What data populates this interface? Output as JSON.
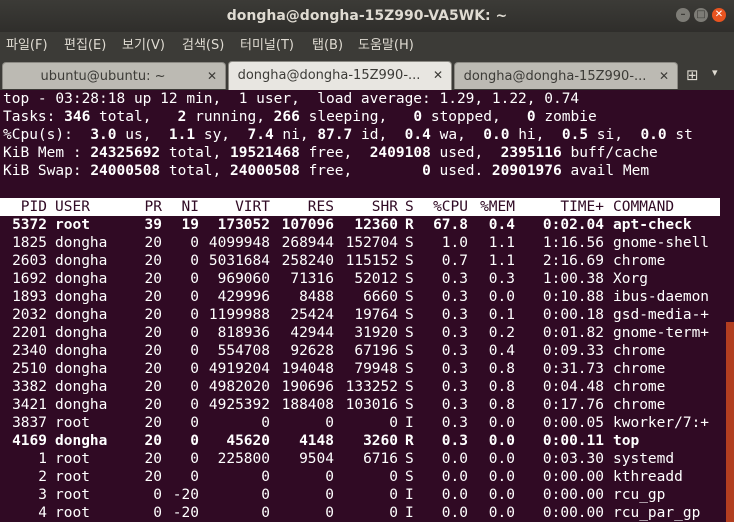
{
  "window": {
    "title": "dongha@dongha-15Z990-VA5WK: ~",
    "buttons": {
      "minimize": "–",
      "maximize": "□",
      "close": "✕"
    }
  },
  "menu": [
    "파일(F)",
    "편집(E)",
    "보기(V)",
    "검색(S)",
    "터미널(T)",
    "탭(B)",
    "도움말(H)"
  ],
  "tabs": [
    {
      "label": "ubuntu@ubuntu: ~",
      "close": "✕"
    },
    {
      "label": "dongha@dongha-15Z990-...",
      "close": "✕"
    },
    {
      "label": "dongha@dongha-15Z990-...",
      "close": "✕"
    }
  ],
  "tab_actions": {
    "new_tab": "⊞",
    "menu": "▾"
  },
  "summary": {
    "l1": "top - 03:28:18 up 12 min,  1 user,  load average: 1.29, 1.22, 0.74",
    "tasks": {
      "label": "Tasks: ",
      "total": "346",
      "total_lbl": " total,   ",
      "running": "2",
      "running_lbl": " running, ",
      "sleeping": "266",
      "sleeping_lbl": " sleeping,   ",
      "stopped": "0",
      "stopped_lbl": " stopped,   ",
      "zombie": "0",
      "zombie_lbl": " zombie"
    },
    "cpu": {
      "label": "%Cpu(s):  ",
      "us": "3.0",
      "us_lbl": " us,  ",
      "sy": "1.1",
      "sy_lbl": " sy,  ",
      "ni": "7.4",
      "ni_lbl": " ni, ",
      "id": "87.7",
      "id_lbl": " id,  ",
      "wa": "0.4",
      "wa_lbl": " wa,  ",
      "hi": "0.0",
      "hi_lbl": " hi,  ",
      "si": "0.5",
      "si_lbl": " si,  ",
      "st": "0.0",
      "st_lbl": " st"
    },
    "mem": {
      "label": "KiB Mem : ",
      "total": "24325692",
      "total_lbl": " total, ",
      "free": "19521468",
      "free_lbl": " free,  ",
      "used": "2409108",
      "used_lbl": " used,  ",
      "buff": "2395116",
      "buff_lbl": " buff/cache"
    },
    "swap": {
      "label": "KiB Swap: ",
      "total": "24000508",
      "total_lbl": " total, ",
      "free": "24000508",
      "free_lbl": " free,        ",
      "used": "0",
      "used_lbl": " used. ",
      "avail": "20901976",
      "avail_lbl": " avail Mem"
    }
  },
  "columns": [
    "PID",
    "USER",
    "PR",
    "NI",
    "VIRT",
    "RES",
    "SHR",
    "S",
    "%CPU",
    "%MEM",
    "TIME+",
    "COMMAND"
  ],
  "processes": [
    {
      "bold": true,
      "c": [
        "5372",
        "root",
        "39",
        "19",
        "173052",
        "107096",
        "12360",
        "R",
        "67.8",
        "0.4",
        "0:02.04",
        "apt-check"
      ]
    },
    {
      "bold": false,
      "c": [
        "1825",
        "dongha",
        "20",
        "0",
        "4099948",
        "268944",
        "152704",
        "S",
        "1.0",
        "1.1",
        "1:16.56",
        "gnome-shell"
      ]
    },
    {
      "bold": false,
      "c": [
        "2603",
        "dongha",
        "20",
        "0",
        "5031684",
        "258240",
        "115152",
        "S",
        "0.7",
        "1.1",
        "2:16.69",
        "chrome"
      ]
    },
    {
      "bold": false,
      "c": [
        "1692",
        "dongha",
        "20",
        "0",
        "969060",
        "71316",
        "52012",
        "S",
        "0.3",
        "0.3",
        "1:00.38",
        "Xorg"
      ]
    },
    {
      "bold": false,
      "c": [
        "1893",
        "dongha",
        "20",
        "0",
        "429996",
        "8488",
        "6660",
        "S",
        "0.3",
        "0.0",
        "0:10.88",
        "ibus-daemon"
      ]
    },
    {
      "bold": false,
      "c": [
        "2032",
        "dongha",
        "20",
        "0",
        "1199988",
        "25424",
        "19764",
        "S",
        "0.3",
        "0.1",
        "0:00.18",
        "gsd-media-+"
      ]
    },
    {
      "bold": false,
      "c": [
        "2201",
        "dongha",
        "20",
        "0",
        "818936",
        "42944",
        "31920",
        "S",
        "0.3",
        "0.2",
        "0:01.82",
        "gnome-term+"
      ]
    },
    {
      "bold": false,
      "c": [
        "2340",
        "dongha",
        "20",
        "0",
        "554708",
        "92628",
        "67196",
        "S",
        "0.3",
        "0.4",
        "0:09.33",
        "chrome"
      ]
    },
    {
      "bold": false,
      "c": [
        "2510",
        "dongha",
        "20",
        "0",
        "4919204",
        "194048",
        "79948",
        "S",
        "0.3",
        "0.8",
        "0:31.73",
        "chrome"
      ]
    },
    {
      "bold": false,
      "c": [
        "3382",
        "dongha",
        "20",
        "0",
        "4982020",
        "190696",
        "133252",
        "S",
        "0.3",
        "0.8",
        "0:04.48",
        "chrome"
      ]
    },
    {
      "bold": false,
      "c": [
        "3421",
        "dongha",
        "20",
        "0",
        "4925392",
        "188408",
        "103016",
        "S",
        "0.3",
        "0.8",
        "0:17.76",
        "chrome"
      ]
    },
    {
      "bold": false,
      "c": [
        "3837",
        "root",
        "20",
        "0",
        "0",
        "0",
        "0",
        "I",
        "0.3",
        "0.0",
        "0:00.05",
        "kworker/7:+"
      ]
    },
    {
      "bold": true,
      "c": [
        "4169",
        "dongha",
        "20",
        "0",
        "45620",
        "4148",
        "3260",
        "R",
        "0.3",
        "0.0",
        "0:00.11",
        "top"
      ]
    },
    {
      "bold": false,
      "c": [
        "1",
        "root",
        "20",
        "0",
        "225800",
        "9504",
        "6716",
        "S",
        "0.0",
        "0.0",
        "0:03.30",
        "systemd"
      ]
    },
    {
      "bold": false,
      "c": [
        "2",
        "root",
        "20",
        "0",
        "0",
        "0",
        "0",
        "S",
        "0.0",
        "0.0",
        "0:00.00",
        "kthreadd"
      ]
    },
    {
      "bold": false,
      "c": [
        "3",
        "root",
        "0",
        "-20",
        "0",
        "0",
        "0",
        "I",
        "0.0",
        "0.0",
        "0:00.00",
        "rcu_gp"
      ]
    },
    {
      "bold": false,
      "c": [
        "4",
        "root",
        "0",
        "-20",
        "0",
        "0",
        "0",
        "I",
        "0.0",
        "0.0",
        "0:00.00",
        "rcu_par_gp"
      ]
    }
  ]
}
